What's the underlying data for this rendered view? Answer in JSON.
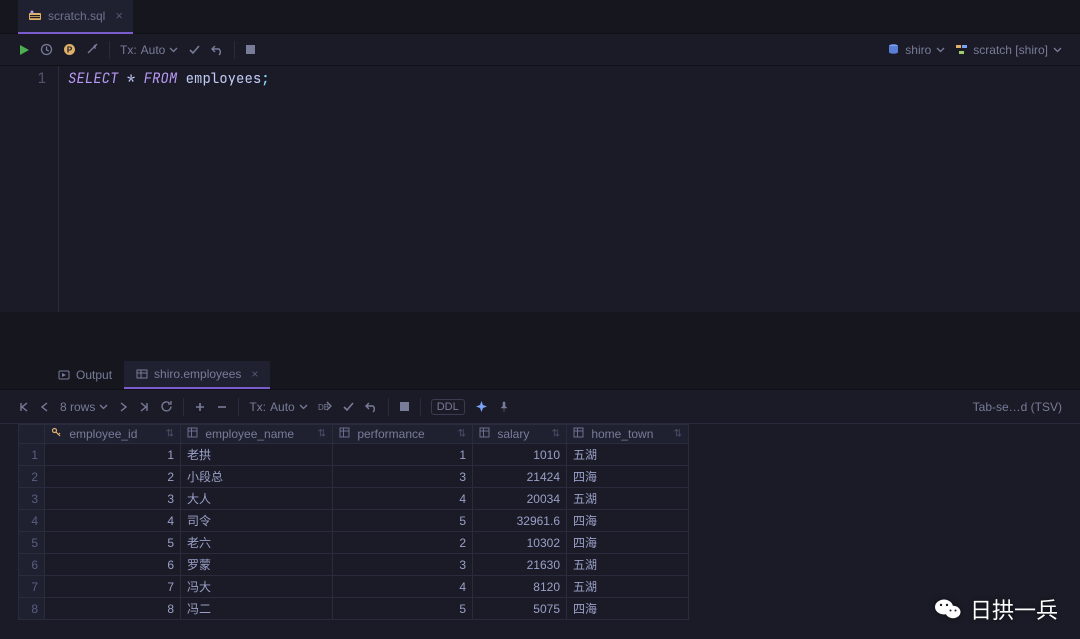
{
  "fileTab": {
    "name": "scratch.sql"
  },
  "toolbar": {
    "tx_label": "Tx:",
    "tx_mode": "Auto",
    "datasource": "shiro",
    "schema": "scratch [shiro]"
  },
  "editor": {
    "line_no": "1",
    "kw_select": "SELECT",
    "star": "*",
    "kw_from": "FROM",
    "table": "employees",
    "semi": ";"
  },
  "resultTabs": {
    "output": "Output",
    "active": "shiro.employees"
  },
  "resultToolbar": {
    "rows": "8 rows",
    "tx_label": "Tx:",
    "tx_mode": "Auto",
    "ddl": "DDL",
    "export": "Tab-se…d (TSV)"
  },
  "columns": [
    "employee_id",
    "employee_name",
    "performance",
    "salary",
    "home_town"
  ],
  "data": [
    {
      "n": 1,
      "employee_id": 1,
      "employee_name": "老拱",
      "performance": 1,
      "salary": "1010",
      "home_town": "五湖"
    },
    {
      "n": 2,
      "employee_id": 2,
      "employee_name": "小段总",
      "performance": 3,
      "salary": "21424",
      "home_town": "四海"
    },
    {
      "n": 3,
      "employee_id": 3,
      "employee_name": "大人",
      "performance": 4,
      "salary": "20034",
      "home_town": "五湖"
    },
    {
      "n": 4,
      "employee_id": 4,
      "employee_name": "司令",
      "performance": 5,
      "salary": "32961.6",
      "home_town": "四海"
    },
    {
      "n": 5,
      "employee_id": 5,
      "employee_name": "老六",
      "performance": 2,
      "salary": "10302",
      "home_town": "四海"
    },
    {
      "n": 6,
      "employee_id": 6,
      "employee_name": "罗蒙",
      "performance": 3,
      "salary": "21630",
      "home_town": "五湖"
    },
    {
      "n": 7,
      "employee_id": 7,
      "employee_name": "冯大",
      "performance": 4,
      "salary": "8120",
      "home_town": "五湖"
    },
    {
      "n": 8,
      "employee_id": 8,
      "employee_name": "冯二",
      "performance": 5,
      "salary": "5075",
      "home_town": "四海"
    }
  ],
  "colWidths": {
    "rownum": 26,
    "employee_id": 136,
    "employee_name": 152,
    "performance": 140,
    "salary": 94,
    "home_town": 122
  },
  "watermark": "日拱一兵"
}
